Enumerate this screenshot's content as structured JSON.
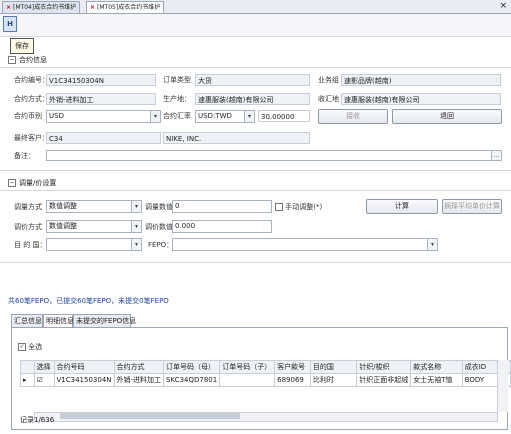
{
  "tabs": [
    {
      "label": "[MT04]成衣合约书维护",
      "active": false
    },
    {
      "label": "[MT05]成衣合约书维护",
      "active": true
    }
  ],
  "close_all": "×",
  "toolbar": {
    "save_tooltip": "保存"
  },
  "contract_section": {
    "title": "合约信息"
  },
  "contract": {
    "no_label": "合约编号：",
    "no_value": "V1C34150304N",
    "type_label": "订单类型",
    "type_value": "大货",
    "dept_label": "业务组",
    "dept_value": "速影品牌(越南)",
    "method_label": "合约方式：",
    "method_value": "外销-进料加工",
    "producer_label": "生产地：",
    "producer_value": "速惠服装(越南)有限公司",
    "recv_label": "收汇地",
    "recv_value": "速惠服装(越南)有限公司",
    "currency_label": "合约币别",
    "currency_value": "USD",
    "rate_label": "合约汇率",
    "rate_currency": "USD:TWD",
    "rate_value": "30.00000",
    "receive_btn": "接收",
    "back_btn": "退回",
    "customer_label": "最终客户：",
    "customer_code": "C34",
    "customer_name": "NIKE, INC.",
    "remark_label": "备注："
  },
  "adjust_section": {
    "title": "调量/价设置"
  },
  "adjust": {
    "qty_method_label": "调量方式",
    "qty_method_value": "数值调整",
    "qty_value_label": "调量数值",
    "qty_value": "0",
    "manual_label": "手动调整(*)",
    "calc_btn": "计算",
    "avg_btn": "摘择平均单价计算",
    "price_method_label": "调价方式",
    "price_method_value": "数值调整",
    "price_value_label": "调价数值",
    "price_value": "0.000",
    "dest_label": "目 的 国：",
    "dest_value": "",
    "fepo_label": "FEPO：",
    "fepo_value": ""
  },
  "summary_text": "共60笔FEPO，已提交60笔FEPO，未提交0笔FEPO",
  "subtabs": [
    {
      "label": "汇总信息",
      "active": false
    },
    {
      "label": "明细信息",
      "active": true
    },
    {
      "label": "未提交的FEPO信息",
      "active": false
    }
  ],
  "select_all_label": "全选",
  "grid": {
    "headers": [
      "选择",
      "合约号码",
      "合约方式",
      "订单号码（母）",
      "订单号码（子）",
      "客户款号",
      "目的国",
      "针织/梭织",
      "款式名称",
      "成衣ID"
    ],
    "rows": [
      [
        "☑",
        "V1C34150304N",
        "外销-进料加工",
        "SKC34QD7801",
        "",
        "689069",
        "比利时",
        "针织正面非起绒",
        "女士无袖T恤",
        "BODY"
      ]
    ]
  },
  "records": "记录1/636"
}
